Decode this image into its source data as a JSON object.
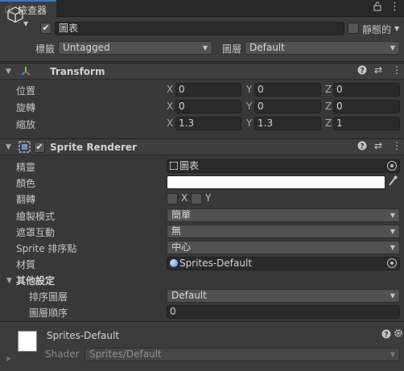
{
  "tab": {
    "icon": "info-icon",
    "glyph": "ⓘ",
    "label": "檢查器",
    "lock_glyph": "🔓",
    "menu_glyph": "⋮"
  },
  "object": {
    "name": "圖表",
    "active": true,
    "static_label": "靜態的",
    "tag_label": "標籤",
    "tag_value": "Untagged",
    "layer_label": "圖層",
    "layer_value": "Default"
  },
  "transform": {
    "title": "Transform",
    "rows": [
      {
        "label": "位置",
        "x": "0",
        "y": "0",
        "z": "0"
      },
      {
        "label": "旋轉",
        "x": "0",
        "y": "0",
        "z": "0"
      },
      {
        "label": "縮放",
        "x": "1.3",
        "y": "1.3",
        "z": "1"
      }
    ],
    "axis": {
      "x": "X",
      "y": "Y",
      "z": "Z"
    }
  },
  "sprite_renderer": {
    "title": "Sprite Renderer",
    "enabled": true,
    "sprite_label": "精靈",
    "sprite_value": "圖表",
    "color_label": "顏色",
    "color_value": "#ffffff",
    "flip_label": "翻轉",
    "flip_x": "X",
    "flip_y": "Y",
    "draw_mode_label": "繪製模式",
    "draw_mode_value": "簡單",
    "mask_label": "遮罩互動",
    "mask_value": "無",
    "pivot_label": "Sprite 排序點",
    "pivot_value": "中心",
    "material_label": "材質",
    "material_value": "Sprites-Default",
    "other_settings": "其他設定",
    "sorting_layer_label": "排序圖層",
    "sorting_layer_value": "Default",
    "order_label": "圖層順序",
    "order_value": "0"
  },
  "material": {
    "name": "Sprites-Default",
    "shader_label": "Shader",
    "shader_value": "Sprites/Default"
  },
  "icons": {
    "help": "❓",
    "presets": "⇄",
    "more": "⋮",
    "fold_open": "▼",
    "fold_closed": "▶",
    "dropdown": "▼",
    "check": "✔",
    "eyedropper": "🖉"
  },
  "colors": {
    "accent": "#3a79bb",
    "background": "#383838"
  }
}
